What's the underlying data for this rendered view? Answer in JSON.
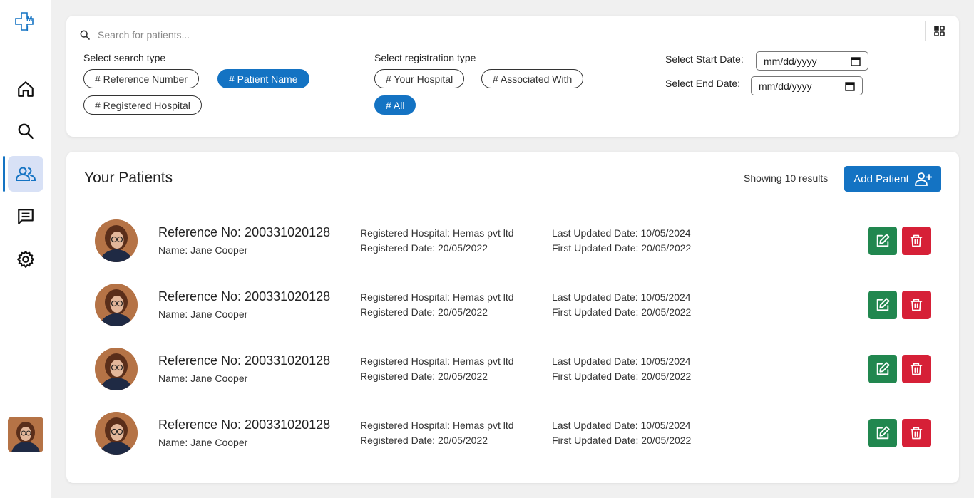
{
  "sidebar": {
    "items": [
      {
        "name": "home",
        "icon": "home-icon"
      },
      {
        "name": "search",
        "icon": "search-icon"
      },
      {
        "name": "patients",
        "icon": "users-icon",
        "active": true
      },
      {
        "name": "messages",
        "icon": "message-icon"
      },
      {
        "name": "settings",
        "icon": "gear-icon"
      }
    ]
  },
  "search": {
    "placeholder": "Search for patients...",
    "search_type_label": "Select search type",
    "search_types": [
      {
        "label": "# Reference Number",
        "active": false
      },
      {
        "label": "# Patient Name",
        "active": true
      },
      {
        "label": "# Registered Hospital",
        "active": false
      }
    ],
    "registration_type_label": "Select registration type",
    "registration_types": [
      {
        "label": "# Your Hospital",
        "active": false
      },
      {
        "label": "# Associated With",
        "active": false
      },
      {
        "label": "# All",
        "active": true
      }
    ],
    "start_date_label": "Select Start Date:",
    "end_date_label": "Select End Date:",
    "start_date_value": "mm/dd/yyyy",
    "end_date_value": "mm/dd/yyyy"
  },
  "patients": {
    "title": "Your Patients",
    "results_text": "Showing 10 results",
    "add_button_label": "Add Patient",
    "rows": [
      {
        "reference": "Reference No: 200331020128",
        "name": "Name: Jane Cooper",
        "hospital": "Registered Hospital: Hemas pvt ltd",
        "registered_date": "Registered Date: 20/05/2022",
        "last_updated": "Last Updated Date: 10/05/2024",
        "first_updated": "First Updated Date: 20/05/2022"
      },
      {
        "reference": "Reference No: 200331020128",
        "name": "Name: Jane Cooper",
        "hospital": "Registered Hospital: Hemas pvt ltd",
        "registered_date": "Registered Date: 20/05/2022",
        "last_updated": "Last Updated Date: 10/05/2024",
        "first_updated": "First Updated Date: 20/05/2022"
      },
      {
        "reference": "Reference No: 200331020128",
        "name": "Name: Jane Cooper",
        "hospital": "Registered Hospital: Hemas pvt ltd",
        "registered_date": "Registered Date: 20/05/2022",
        "last_updated": "Last Updated Date: 10/05/2024",
        "first_updated": "First Updated Date: 20/05/2022"
      },
      {
        "reference": "Reference No: 200331020128",
        "name": "Name: Jane Cooper",
        "hospital": "Registered Hospital: Hemas pvt ltd",
        "registered_date": "Registered Date: 20/05/2022",
        "last_updated": "Last Updated Date: 10/05/2024",
        "first_updated": "First Updated Date: 20/05/2022"
      }
    ]
  },
  "colors": {
    "primary": "#1473c3",
    "edit": "#21874f",
    "delete": "#d62037",
    "active_nav_bg": "#d8e1f6"
  }
}
